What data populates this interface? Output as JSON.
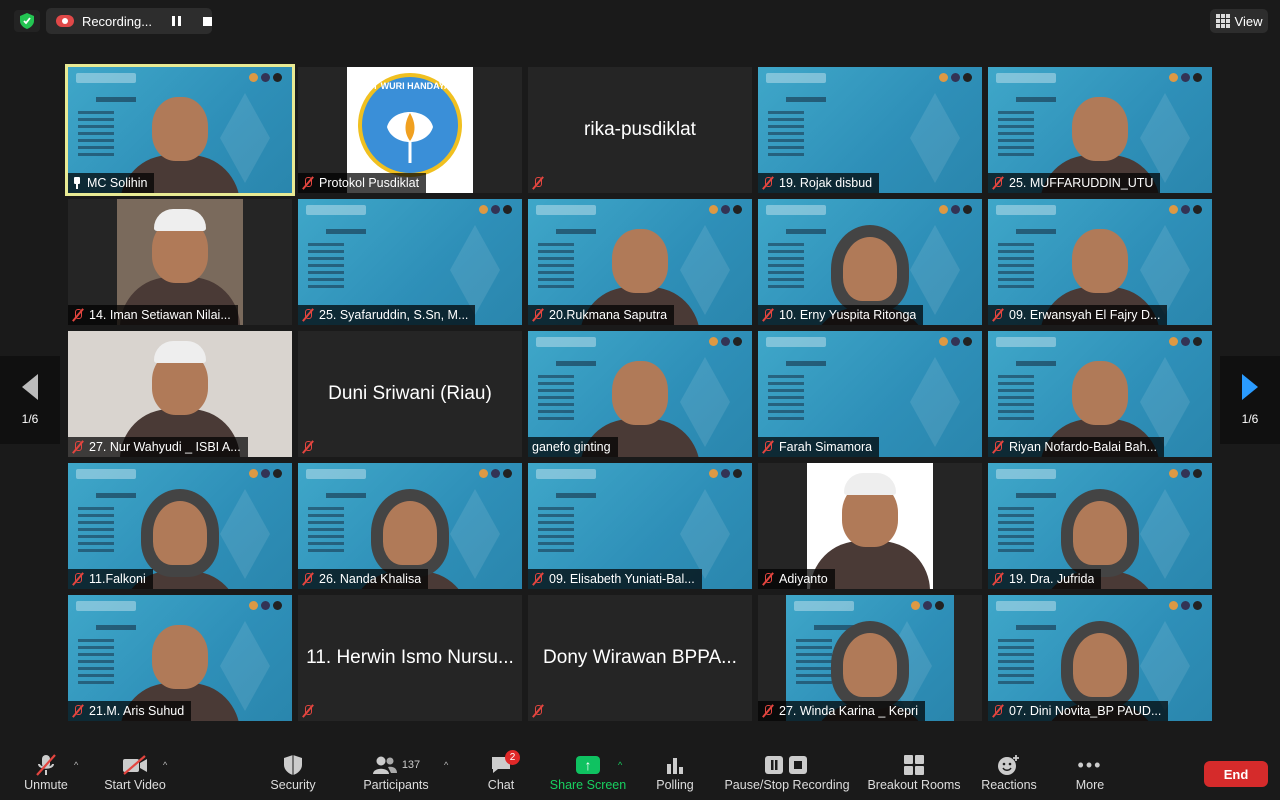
{
  "topbar": {
    "recording_label": "Recording...",
    "view_label": "View"
  },
  "pager": {
    "left_label": "1/6",
    "right_label": "1/6"
  },
  "tiles": [
    {
      "name": "MC Solihin",
      "kind": "slide-person",
      "mic": "pin",
      "active": true
    },
    {
      "name": "Protokol Pusdiklat",
      "kind": "logo",
      "mic": "muted",
      "logo_text": "TUT WURI HANDAYANI"
    },
    {
      "name": "rika-pusdiklat",
      "kind": "name-only",
      "mic": "muted"
    },
    {
      "name": "19. Rojak disbud",
      "kind": "slide",
      "mic": "muted"
    },
    {
      "name": "25. MUFFARUDDIN_UTU",
      "kind": "slide-person",
      "mic": "muted"
    },
    {
      "name": "14. Iman Setiawan Nilai...",
      "kind": "photo",
      "mic": "muted"
    },
    {
      "name": "25. Syafaruddin, S.Sn, M...",
      "kind": "slide",
      "mic": "muted"
    },
    {
      "name": "20.Rukmana Saputra",
      "kind": "slide-person",
      "mic": "muted"
    },
    {
      "name": "10. Erny Yuspita Ritonga",
      "kind": "slide-hijab",
      "mic": "muted"
    },
    {
      "name": "09. Erwansyah El Fajry D...",
      "kind": "slide-person",
      "mic": "muted"
    },
    {
      "name": "27. Nur Wahyudi _ ISBI A...",
      "kind": "photo",
      "mic": "muted"
    },
    {
      "name": "Duni Sriwani (Riau)",
      "kind": "name-only",
      "mic": "muted"
    },
    {
      "name": "ganefo ginting",
      "kind": "slide-person",
      "mic": "none"
    },
    {
      "name": "Farah Simamora",
      "kind": "slide",
      "mic": "muted"
    },
    {
      "name": "Riyan Nofardo-Balai Bah...",
      "kind": "slide-person",
      "mic": "muted"
    },
    {
      "name": "11.Falkoni",
      "kind": "slide-hijab",
      "mic": "muted"
    },
    {
      "name": "26. Nanda Khalisa",
      "kind": "slide-hijab",
      "mic": "muted"
    },
    {
      "name": "09. Elisabeth Yuniati-Bal...",
      "kind": "slide",
      "mic": "muted"
    },
    {
      "name": "Adiyanto",
      "kind": "photo-white",
      "mic": "muted"
    },
    {
      "name": "19. Dra. Jufrida",
      "kind": "slide-hijab",
      "mic": "muted"
    },
    {
      "name": "21.M. Aris Suhud",
      "kind": "slide-person",
      "mic": "muted"
    },
    {
      "name": "11. Herwin Ismo Nursu...",
      "kind": "name-only-noname",
      "mic": "muted",
      "big": "11. Herwin Ismo Nursu..."
    },
    {
      "name": "Dony Wirawan BPPA...",
      "kind": "name-only-noname",
      "mic": "muted",
      "big": "Dony Wirawan BPPA..."
    },
    {
      "name": "27. Winda Karina _ Kepri",
      "kind": "slide-hijab-narrow",
      "mic": "muted"
    },
    {
      "name": "07. Dini Novita_BP PAUD...",
      "kind": "slide-hijab",
      "mic": "muted"
    }
  ],
  "toolbar": {
    "unmute": "Unmute",
    "start_video": "Start Video",
    "security": "Security",
    "participants": "Participants",
    "participants_count": "137",
    "chat": "Chat",
    "chat_badge": "2",
    "share_screen": "Share Screen",
    "polling": "Polling",
    "pause_stop_recording": "Pause/Stop Recording",
    "breakout_rooms": "Breakout Rooms",
    "reactions": "Reactions",
    "more": "More",
    "end": "End"
  },
  "colors": {
    "active_speaker": "#e8ea94",
    "share_green": "#18d060",
    "end_red": "#d52b2b",
    "muted_red": "#e3453f"
  }
}
